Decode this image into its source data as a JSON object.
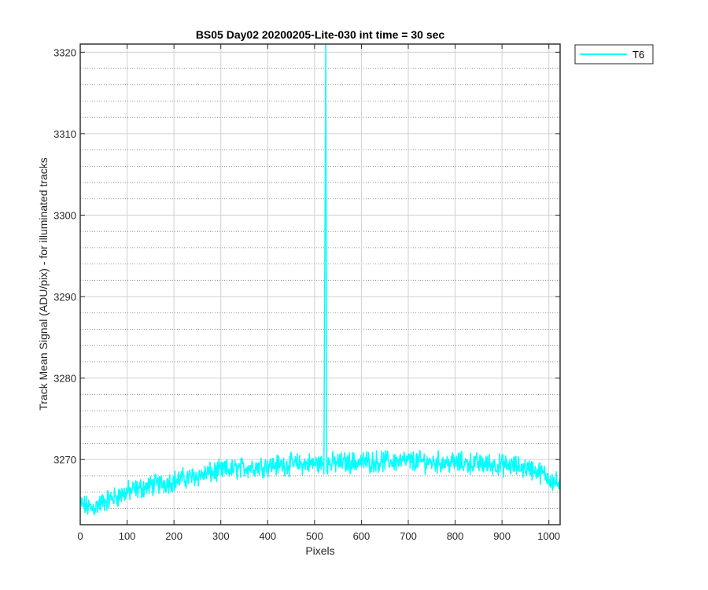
{
  "chart_data": {
    "type": "line",
    "title": "BS05 Day02 20200205-Lite-030 int time = 30 sec",
    "xlabel": "Pixels",
    "ylabel": "Track Mean Signal (ADU/pix) - for illuminated tracks",
    "xlim": [
      0,
      1024
    ],
    "ylim": [
      3262,
      3321
    ],
    "x_ticks": [
      0,
      100,
      200,
      300,
      400,
      500,
      600,
      700,
      800,
      900,
      1000
    ],
    "y_ticks": [
      3270,
      3280,
      3290,
      3300,
      3310,
      3320
    ],
    "x_tick_labels": [
      "0",
      "100",
      "200",
      "300",
      "400",
      "500",
      "600",
      "700",
      "800",
      "900",
      "1000"
    ],
    "y_tick_labels": [
      "3270",
      "3280",
      "3290",
      "3300",
      "3310",
      "3320"
    ],
    "grid": true,
    "minor_grid": true,
    "legend_position": "outside-top-right",
    "series": [
      {
        "name": "T6",
        "color": "#00FFFF",
        "x": [
          0,
          25,
          50,
          100,
          150,
          200,
          250,
          300,
          350,
          400,
          450,
          500,
          520,
          524,
          526,
          530,
          550,
          600,
          650,
          700,
          750,
          800,
          850,
          900,
          950,
          975,
          1000,
          1024
        ],
        "y": [
          3264.5,
          3264.0,
          3264.8,
          3266.0,
          3266.8,
          3267.4,
          3268.0,
          3268.6,
          3269.0,
          3269.3,
          3269.4,
          3269.5,
          3269.5,
          3321,
          3269.5,
          3269.5,
          3269.6,
          3269.7,
          3269.8,
          3269.8,
          3269.7,
          3269.6,
          3269.5,
          3269.3,
          3269.0,
          3268.6,
          3267.8,
          3266.8
        ],
        "noise_amplitude": 1.0
      }
    ]
  }
}
